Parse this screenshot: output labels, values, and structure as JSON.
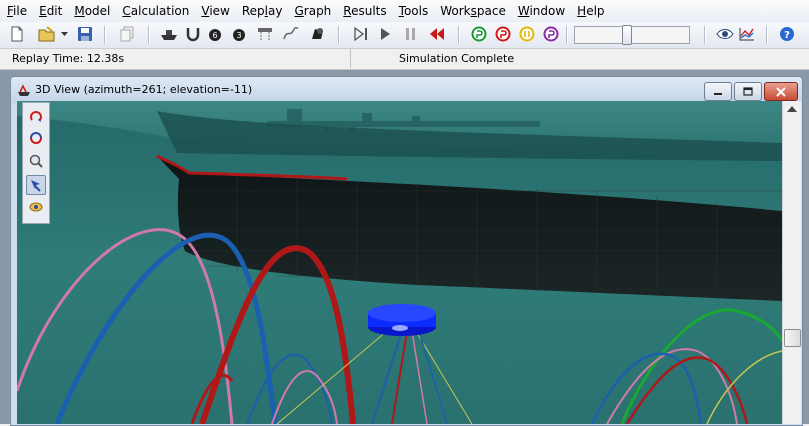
{
  "menubar": {
    "items": [
      {
        "label": "File",
        "ul": "F",
        "rest": "ile"
      },
      {
        "label": "Edit",
        "ul": "E",
        "rest": "dit"
      },
      {
        "label": "Model",
        "ul": "M",
        "rest": "odel"
      },
      {
        "label": "Calculation",
        "ul": "C",
        "rest": "alculation"
      },
      {
        "label": "View",
        "ul": "V",
        "rest": "iew"
      },
      {
        "label": "Replay",
        "pre": "Rep",
        "ul": "l",
        "rest": "ay"
      },
      {
        "label": "Graph",
        "ul": "G",
        "rest": "raph"
      },
      {
        "label": "Results",
        "ul": "R",
        "rest": "esults"
      },
      {
        "label": "Tools",
        "ul": "T",
        "rest": "ools"
      },
      {
        "label": "Workspace",
        "pre": "Work",
        "ul": "s",
        "rest": "pace"
      },
      {
        "label": "Window",
        "ul": "W",
        "rest": "indow"
      },
      {
        "label": "Help",
        "ul": "H",
        "rest": "elp"
      }
    ]
  },
  "toolbar": {
    "icons": [
      "new-document-icon",
      "open-folder-icon",
      "dropdown-arrow-icon",
      "save-icon",
      "copy-disabled-icon",
      "vessel-icon",
      "line-icon",
      "buoy-6d-icon",
      "buoy-3d-icon",
      "winch-icon",
      "link-icon",
      "shape-icon",
      "step-forward-icon",
      "play-icon",
      "pause-icon",
      "rewind-icon",
      "static-calc-icon",
      "dynamic-calc-icon",
      "pause-calc-icon",
      "reset-calc-icon",
      "eye-icon",
      "graph-icon",
      "help-icon"
    ],
    "replay_slider_position": 0.45
  },
  "status": {
    "replay_time": "Replay Time: 12.38s",
    "simulation_state": "Simulation Complete"
  },
  "window_3d": {
    "title": "3D View (azimuth=261; elevation=-11)"
  },
  "view_tools": [
    "rotate-icon",
    "pan-icon",
    "zoom-icon",
    "select-icon",
    "label-icon"
  ],
  "colors": {
    "water": "#2e7a78",
    "hull": "#161d1e",
    "buoy": "#0a2cff",
    "line_blue": "#1a5fb0",
    "line_red": "#b01818",
    "line_pink": "#d07aa8",
    "line_green": "#1aa832",
    "line_yellow": "#c8c850"
  }
}
